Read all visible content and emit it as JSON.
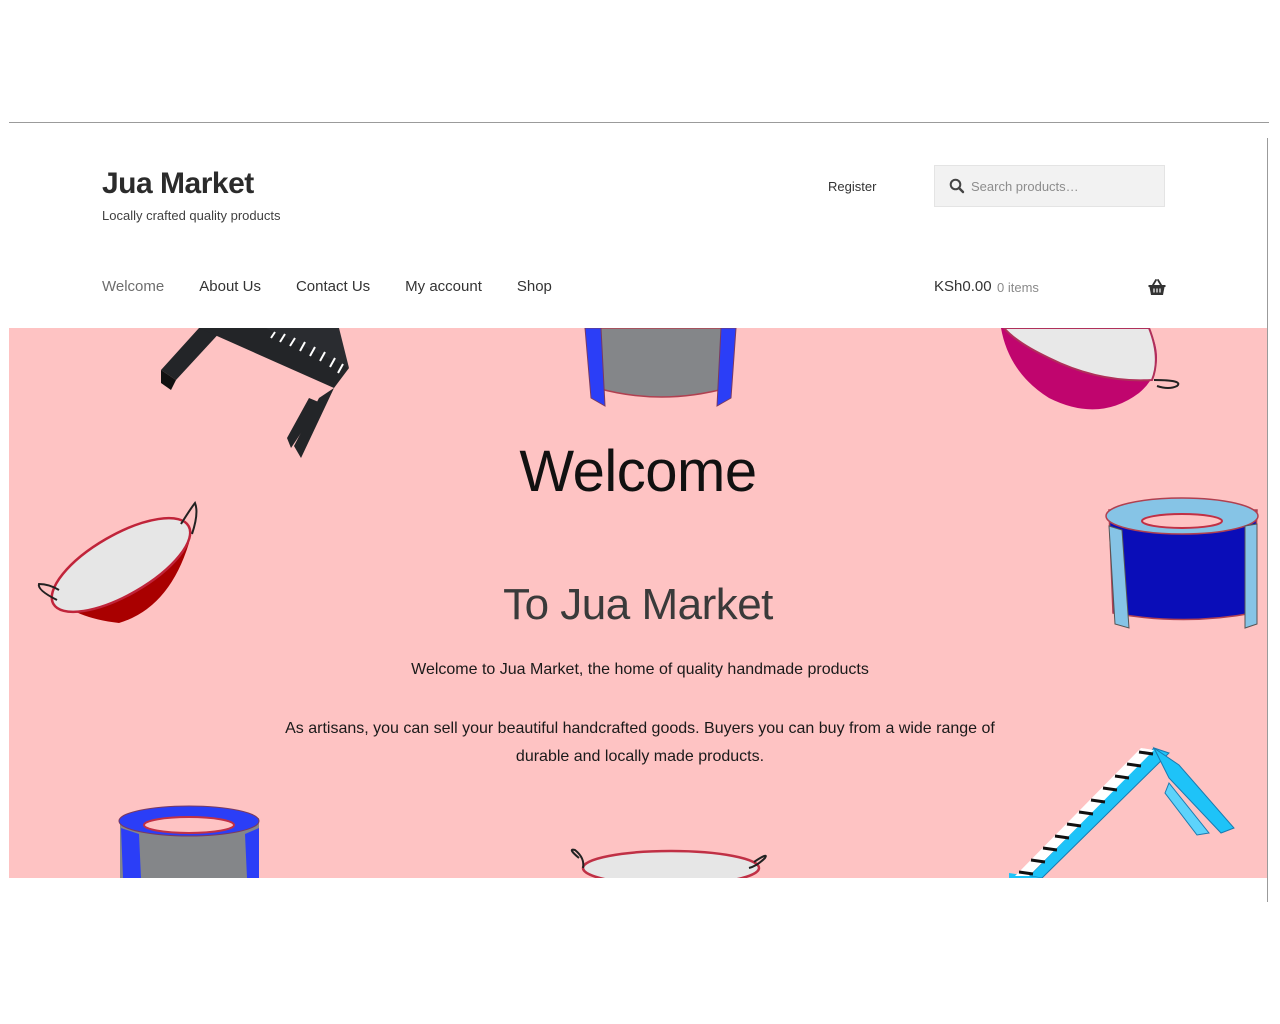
{
  "site": {
    "title": "Jua Market",
    "tagline": "Locally crafted quality products"
  },
  "header": {
    "register_label": "Register",
    "search_placeholder": "Search products…"
  },
  "nav": {
    "items": [
      {
        "label": "Welcome",
        "current": true
      },
      {
        "label": "About Us"
      },
      {
        "label": "Contact Us"
      },
      {
        "label": "My account"
      },
      {
        "label": "Shop"
      }
    ]
  },
  "cart": {
    "amount": "KSh0.00",
    "count": "0 items",
    "icon": "basket-icon"
  },
  "hero": {
    "title": "Welcome",
    "subtitle": "To Jua Market",
    "paragraph1": "Welcome to Jua Market, the home of quality handmade products",
    "paragraph2": "As artisans, you can sell your beautiful handcrafted goods. Buyers you can buy from a wide range of durable and locally made products.",
    "background_color": "#fec3c3"
  }
}
